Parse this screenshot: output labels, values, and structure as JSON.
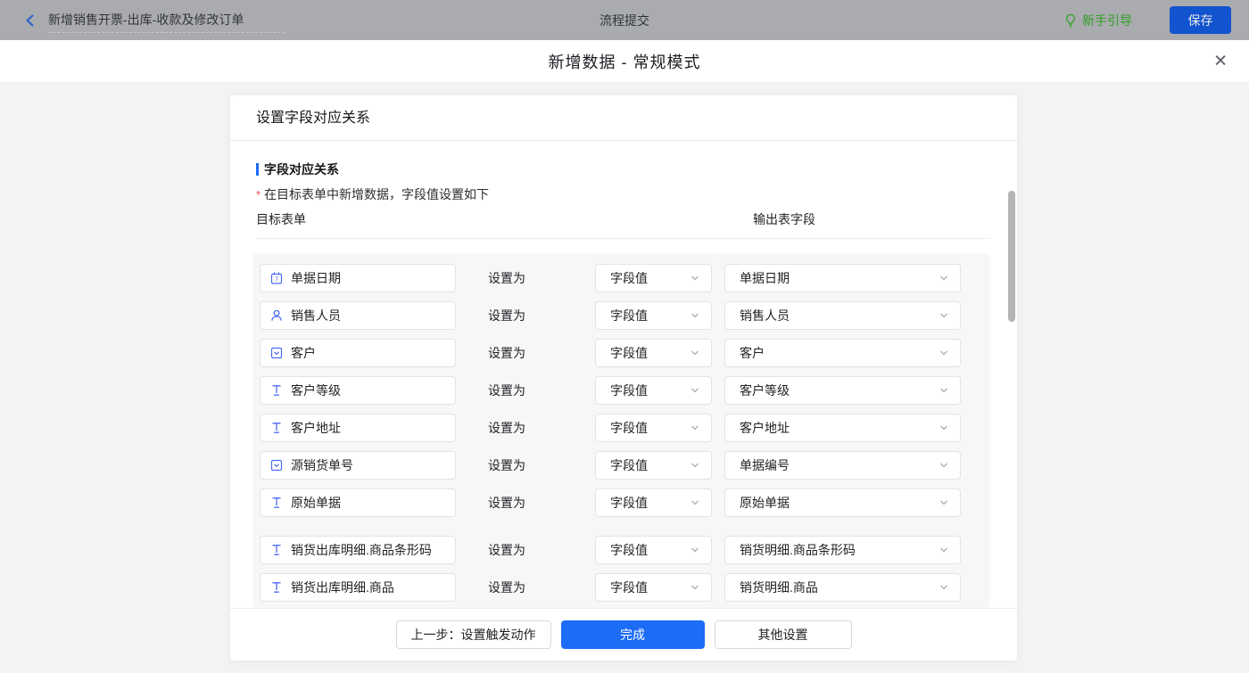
{
  "topbar": {
    "back_title": "新增销售开票-出库-收款及修改订单",
    "center_title": "流程提交",
    "guide_label": "新手引导",
    "save_label": "保存"
  },
  "modal": {
    "title": "新增数据 - 常规模式",
    "close_glyph": "✕"
  },
  "card": {
    "header": "设置字段对应关系",
    "section_title": "字段对应关系",
    "required_mark": "*",
    "section_desc": "在目标表单中新增数据，字段值设置如下",
    "col_left": "目标表单",
    "col_right": "输出表字段",
    "rows": [
      {
        "icon": "calendar-icon",
        "field": "单据日期",
        "set_as": "设置为",
        "mode": "字段值",
        "output": "单据日期"
      },
      {
        "icon": "user-icon",
        "field": "销售人员",
        "set_as": "设置为",
        "mode": "字段值",
        "output": "销售人员"
      },
      {
        "icon": "select-icon",
        "field": "客户",
        "set_as": "设置为",
        "mode": "字段值",
        "output": "客户"
      },
      {
        "icon": "text-icon",
        "field": "客户等级",
        "set_as": "设置为",
        "mode": "字段值",
        "output": "客户等级"
      },
      {
        "icon": "text-icon",
        "field": "客户地址",
        "set_as": "设置为",
        "mode": "字段值",
        "output": "客户地址"
      },
      {
        "icon": "select-icon",
        "field": "源销货单号",
        "set_as": "设置为",
        "mode": "字段值",
        "output": "单据编号"
      },
      {
        "icon": "text-icon",
        "field": "原始单据",
        "set_as": "设置为",
        "mode": "字段值",
        "output": "原始单据"
      },
      {
        "icon": "text-icon",
        "field": "销货出库明细.商品条形码",
        "set_as": "设置为",
        "mode": "字段值",
        "output": "销货明细.商品条形码"
      },
      {
        "icon": "text-icon",
        "field": "销货出库明细.商品",
        "set_as": "设置为",
        "mode": "字段值",
        "output": "销货明细.商品"
      }
    ],
    "footer": {
      "prev_label": "上一步：设置触发动作",
      "done_label": "完成",
      "other_label": "其他设置"
    }
  },
  "colors": {
    "topbar_bg": "#a9abae",
    "accent_blue": "#1c6cf5",
    "save_btn_blue": "#1254cf",
    "guide_green": "#2f9e25",
    "required_red": "#e34d4d",
    "panel_bg": "#f7f7f8",
    "page_bg": "#f3f3f4",
    "field_icon_blue": "#4a6bf5"
  }
}
